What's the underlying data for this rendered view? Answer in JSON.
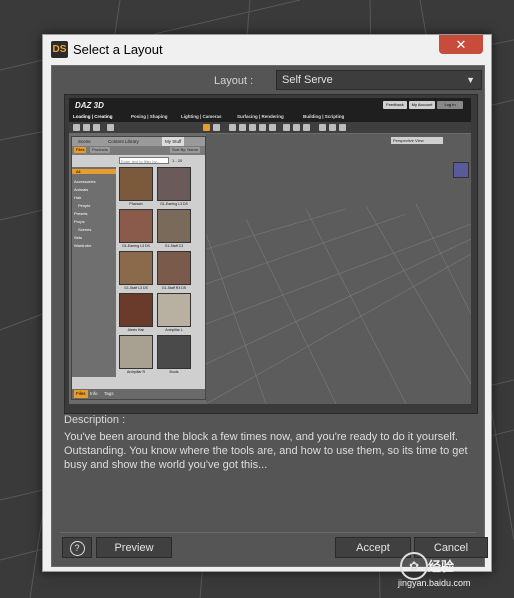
{
  "window": {
    "app_icon_text": "DS",
    "title": "Select a Layout",
    "close_glyph": "✕"
  },
  "layout": {
    "label": "Layout :",
    "selected": "Self Serve",
    "arrow": "▼"
  },
  "preview_app": {
    "logo": "DAZ 3D",
    "top_buttons": [
      "Feedback",
      "My Account",
      "Log In"
    ],
    "tabs": [
      "Loading | Creating",
      "Posing | Shaping",
      "Lighting | Cameras",
      "Surfacing | Rendering",
      "Building | Scripting"
    ],
    "library_tabs": [
      "Scene",
      "Content Library",
      "My Stuff"
    ],
    "subtabs": [
      "Files",
      "Products"
    ],
    "filter_placeholder": "Enter text to filter by...",
    "sort_label": "Sort By: Name",
    "page_count": "1 - 20",
    "categories": [
      "All",
      "Accessories",
      "Animals",
      "Hair",
      "People",
      "Presets",
      "Props",
      "Scenes",
      "Sets",
      "Wardrobe"
    ],
    "thumbs": [
      {
        "caption": "Pharaoh",
        "color": "#7a5a3a"
      },
      {
        "caption": "G1-Earring L3 DS",
        "color": "#6a5a5a"
      },
      {
        "caption": "G1-Earring L3 DS",
        "color": "#8a5a4a"
      },
      {
        "caption": "G1-Staff C3",
        "color": "#7a6a5a"
      },
      {
        "caption": "G1-Staff L3 DS",
        "color": "#8a6a4a"
      },
      {
        "caption": "G1-Staff R3 DS",
        "color": "#7a5a4a"
      },
      {
        "caption": "Alexis Hair",
        "color": "#6a3a2a"
      },
      {
        "caption": "Archpillar L",
        "color": "#b8b0a0"
      },
      {
        "caption": "Archpillar R",
        "color": "#a8a090"
      },
      {
        "caption": "Boots",
        "color": "#4a4a4a"
      }
    ],
    "footer_tabs": [
      "Files",
      "Info",
      "Tags"
    ],
    "viewport_label": "Perspective View"
  },
  "description": {
    "label": "Description :",
    "text": "You've been around the block a few times now, and you're ready to do it yourself. Outstanding. You know where the tools are, and how to use them, so its time to get busy and show the world you've got this..."
  },
  "footer": {
    "help_glyph": "?",
    "preview": "Preview",
    "accept": "Accept",
    "cancel": "Cancel"
  },
  "watermark": {
    "site": "经验",
    "url": "jingyan.baidu.com"
  }
}
